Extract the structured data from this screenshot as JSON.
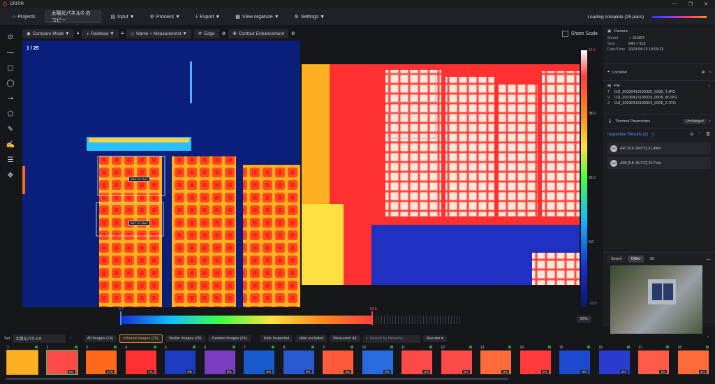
{
  "app": {
    "name": "CRITIR"
  },
  "menubar": {
    "projects": "Projects",
    "project_title": "太陽光パネル® のコピー",
    "input": "Input ▼",
    "process": "Process ▼",
    "export": "Export ▼",
    "view": "View  organize ▼",
    "settings": "Settings ▼",
    "loading": "Loading complete (25 pairs)"
  },
  "toolbar": {
    "compare": "Compare Mode ▼",
    "palette": "Rainbow ▼",
    "name_measure": "Name + Measurement ▼",
    "edge": "Edge",
    "contour": "Contour Enhancement",
    "share_scale": "Share Scale"
  },
  "viewer": {
    "counter": "1 / 25",
    "roi1": "AR6: 24.71m²",
    "roi2": "AR7: 21.49m²",
    "scale_max": "54.0",
    "scale_38": "38.0",
    "scale_22": "22.0",
    "scale_6": "6.0",
    "scale_min": "-10.0",
    "hist_low": "0.7",
    "hist_high": "59.6",
    "zoom": "95%"
  },
  "camera": {
    "header": "Camera",
    "model_label": "Model",
    "model": "ZH20T",
    "size_label": "Size",
    "size": "640 × 512",
    "date_label": "Date/Time",
    "date": "2023:04:13 10:03:23"
  },
  "location": {
    "header": "Location"
  },
  "file": {
    "header": "File",
    "t_label": "T",
    "t": "DJI_20230413100325_0008_T.JPG",
    "v_label": "V",
    "v": "DJI_20230413100324_0008_W.JPG",
    "z_label": "Z",
    "z": "DJI_20230413100324_0008_Z.JPG"
  },
  "thermal": {
    "header": "Thermal Parameters",
    "status": "Unchanged"
  },
  "inspection": {
    "header": "Inspection Results (2)",
    "r1_id": "AR7",
    "r1": "AR7  [6.6~34.0°C] 21.49m²",
    "r2_id": "AR6",
    "r2": "AR6  [5.8~36.2°C] 24.71m²"
  },
  "map": {
    "tab_space": "Space",
    "tab_ortho": "Ortho",
    "tab_3d": "3D"
  },
  "filmstrip": {
    "set_label": "Set",
    "set_value": "太陽光パネル®",
    "all": "All Images (74)",
    "ir": "Infrared Images (25)",
    "visible": "Visible Images (25)",
    "zoomed": "Zoomed Images (24)",
    "hide_inspected": "Hide Inspected",
    "hide_excluded": "Hide excluded",
    "measured": "Measured: All",
    "search_placeholder": "Search by filename...",
    "reorder": "Reorder",
    "thumbs": [
      {
        "n": "1",
        "p": ""
      },
      {
        "n": "2",
        "p": "6%"
      },
      {
        "n": "3",
        "p": "47%"
      },
      {
        "n": "4",
        "p": "7%"
      },
      {
        "n": "5",
        "p": "0%"
      },
      {
        "n": "6",
        "p": "0%"
      },
      {
        "n": "7",
        "p": "0%"
      },
      {
        "n": "8",
        "p": "0%"
      },
      {
        "n": "9",
        "p": "0%"
      },
      {
        "n": "10",
        "p": "0%"
      },
      {
        "n": "11",
        "p": "0%"
      },
      {
        "n": "12",
        "p": "0%"
      },
      {
        "n": "13",
        "p": "0%"
      },
      {
        "n": "14",
        "p": "0%"
      },
      {
        "n": "15",
        "p": "0%"
      },
      {
        "n": "16",
        "p": "0%"
      },
      {
        "n": "17",
        "p": "0%"
      },
      {
        "n": "18",
        "p": "0%"
      }
    ]
  },
  "colors": {
    "accent": "#e08a2a",
    "brand": "#e0383f",
    "panel": "#1f2226"
  }
}
